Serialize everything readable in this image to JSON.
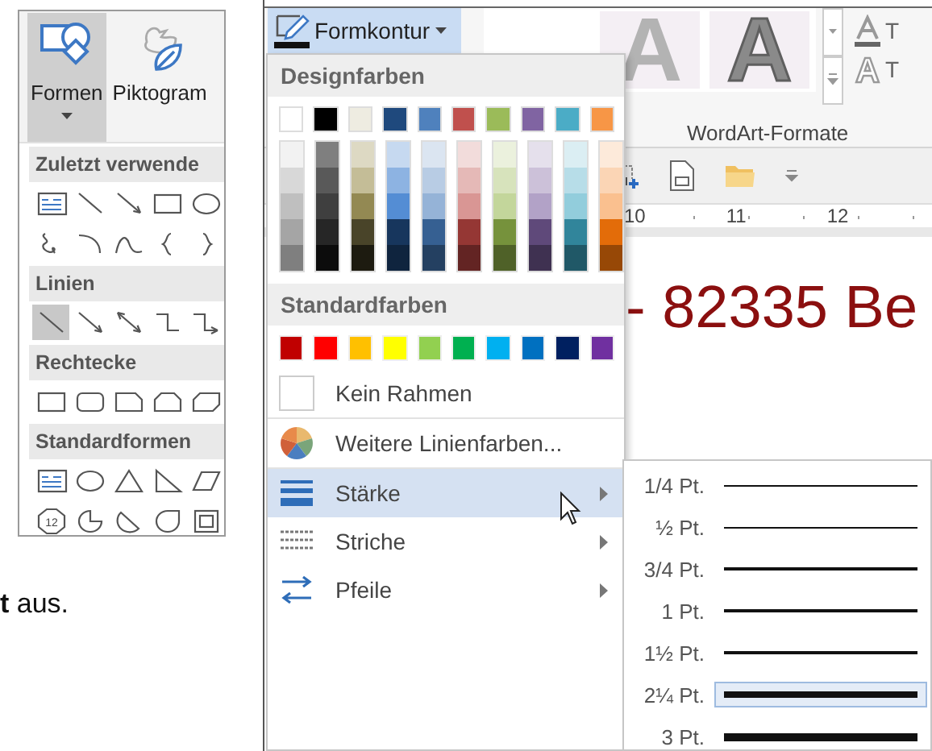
{
  "left_panel": {
    "buttons": [
      {
        "label": "Formen",
        "kind": "shapes",
        "selected": true
      },
      {
        "label": "Piktogram",
        "kind": "icons",
        "selected": false
      }
    ],
    "sections": [
      {
        "title": "Zuletzt verwende",
        "rows": [
          [
            {
              "kind": "textbox",
              "selected": false
            },
            {
              "kind": "line",
              "selected": false
            },
            {
              "kind": "arrow",
              "selected": false
            },
            {
              "kind": "rect",
              "selected": false
            },
            {
              "kind": "oval",
              "selected": false
            }
          ],
          [
            {
              "kind": "scribble",
              "selected": false
            },
            {
              "kind": "arc",
              "selected": false
            },
            {
              "kind": "wave",
              "selected": false
            },
            {
              "kind": "brace-left",
              "selected": false
            },
            {
              "kind": "brace-right",
              "selected": false
            }
          ]
        ]
      },
      {
        "title": "Linien",
        "rows": [
          [
            {
              "kind": "line",
              "selected": true
            },
            {
              "kind": "arrow",
              "selected": false
            },
            {
              "kind": "double-arrow",
              "selected": false
            },
            {
              "kind": "elbow",
              "selected": false
            },
            {
              "kind": "elbow-arrow",
              "selected": false
            }
          ]
        ]
      },
      {
        "title": "Rechtecke",
        "rows": [
          [
            {
              "kind": "rect",
              "selected": false
            },
            {
              "kind": "rounded-rect",
              "selected": false
            },
            {
              "kind": "snip-rect",
              "selected": false
            },
            {
              "kind": "snip2-rect",
              "selected": false
            },
            {
              "kind": "snip-diag",
              "selected": false
            }
          ]
        ]
      },
      {
        "title": "Standardformen",
        "rows": [
          [
            {
              "kind": "textbox",
              "selected": false
            },
            {
              "kind": "oval",
              "selected": false
            },
            {
              "kind": "triangle",
              "selected": false
            },
            {
              "kind": "right-triangle",
              "selected": false
            },
            {
              "kind": "parallelogram",
              "selected": false
            }
          ],
          [
            {
              "kind": "octagon",
              "label": "12",
              "selected": false
            },
            {
              "kind": "pie",
              "selected": false
            },
            {
              "kind": "chord",
              "selected": false
            },
            {
              "kind": "teardrop",
              "selected": false
            },
            {
              "kind": "frame",
              "selected": false
            }
          ]
        ]
      }
    ],
    "caption": "**t** aus."
  },
  "ribbon": {
    "outline_button": {
      "label": "Formkontur",
      "expanded": true
    },
    "wordart_styles": [
      {
        "label": "A",
        "kind": "soft"
      },
      {
        "label": "A",
        "kind": "outline"
      }
    ],
    "text_buttons": [
      {
        "label": "T",
        "kind": "fill"
      },
      {
        "label": "T",
        "kind": "outline"
      }
    ],
    "group_label": "WordArt-Formate"
  },
  "ruler": {
    "labels": [
      "10",
      "11",
      "12"
    ]
  },
  "document": {
    "lines": [
      "- 82335 Be"
    ]
  },
  "outline_menu": {
    "design_title": "Designfarben",
    "design_colors": [
      {
        "color": "#ffffff",
        "shades": [
          {
            "color": "#f2f2f2"
          },
          {
            "color": "#d8d8d8"
          },
          {
            "color": "#bfbfbf"
          },
          {
            "color": "#a5a5a5"
          },
          {
            "color": "#7f7f7f"
          }
        ]
      },
      {
        "color": "#000000",
        "shades": [
          {
            "color": "#7f7f7f"
          },
          {
            "color": "#595959"
          },
          {
            "color": "#3f3f3f"
          },
          {
            "color": "#262626"
          },
          {
            "color": "#0c0c0c"
          }
        ]
      },
      {
        "color": "#eeece1",
        "shades": [
          {
            "color": "#ddd9c3"
          },
          {
            "color": "#c4bd97"
          },
          {
            "color": "#938953"
          },
          {
            "color": "#494429"
          },
          {
            "color": "#1d1b10"
          }
        ]
      },
      {
        "color": "#1f497d",
        "shades": [
          {
            "color": "#c6d9f0"
          },
          {
            "color": "#8db3e2"
          },
          {
            "color": "#548dd4"
          },
          {
            "color": "#17365d"
          },
          {
            "color": "#0f243e"
          }
        ]
      },
      {
        "color": "#4f81bd",
        "shades": [
          {
            "color": "#dbe5f1"
          },
          {
            "color": "#b8cce4"
          },
          {
            "color": "#95b3d7"
          },
          {
            "color": "#366092"
          },
          {
            "color": "#244061"
          }
        ]
      },
      {
        "color": "#c0504d",
        "shades": [
          {
            "color": "#f2dcdb"
          },
          {
            "color": "#e5b9b7"
          },
          {
            "color": "#d99694"
          },
          {
            "color": "#953734"
          },
          {
            "color": "#632423"
          }
        ]
      },
      {
        "color": "#9bbb59",
        "shades": [
          {
            "color": "#ebf1dd"
          },
          {
            "color": "#d7e3bc"
          },
          {
            "color": "#c3d69b"
          },
          {
            "color": "#76923c"
          },
          {
            "color": "#4f6128"
          }
        ]
      },
      {
        "color": "#8064a2",
        "shades": [
          {
            "color": "#e5e0ec"
          },
          {
            "color": "#ccc1d9"
          },
          {
            "color": "#b2a2c7"
          },
          {
            "color": "#5f497a"
          },
          {
            "color": "#3f3151"
          }
        ]
      },
      {
        "color": "#4bacc6",
        "shades": [
          {
            "color": "#dbeef3"
          },
          {
            "color": "#b7dde8"
          },
          {
            "color": "#92cddc"
          },
          {
            "color": "#31859b"
          },
          {
            "color": "#205867"
          }
        ]
      },
      {
        "color": "#f79646",
        "shades": [
          {
            "color": "#fdeada"
          },
          {
            "color": "#fbd5b5"
          },
          {
            "color": "#fac08f"
          },
          {
            "color": "#e36c09"
          },
          {
            "color": "#974806"
          }
        ]
      }
    ],
    "standard_title": "Standardfarben",
    "standard_colors": [
      {
        "color": "#c00000"
      },
      {
        "color": "#ff0000"
      },
      {
        "color": "#ffc000"
      },
      {
        "color": "#ffff00"
      },
      {
        "color": "#92d050"
      },
      {
        "color": "#00b050"
      },
      {
        "color": "#00b0f0"
      },
      {
        "color": "#0070c0"
      },
      {
        "color": "#002060"
      },
      {
        "color": "#7030a0"
      }
    ],
    "items": [
      {
        "label": "Kein Rahmen",
        "kind": "no-outline",
        "selected": false,
        "submenu": false
      },
      {
        "label": "Weitere Linienfarben...",
        "kind": "more-colors",
        "selected": false,
        "submenu": false
      },
      {
        "label": "Stärke",
        "kind": "weight",
        "selected": true,
        "submenu": true
      },
      {
        "label": "Striche",
        "kind": "dashes",
        "selected": false,
        "submenu": true
      },
      {
        "label": "Pfeile",
        "kind": "arrows",
        "selected": false,
        "submenu": true
      }
    ]
  },
  "weight_menu": [
    {
      "label": "1/4 Pt.",
      "selected": false
    },
    {
      "label": "½ Pt.",
      "selected": false
    },
    {
      "label": "3/4 Pt.",
      "selected": false
    },
    {
      "label": "1 Pt.",
      "selected": false
    },
    {
      "label": "1½ Pt.",
      "selected": false
    },
    {
      "label": "2¼ Pt.",
      "selected": true
    },
    {
      "label": "3 Pt.",
      "selected": false
    }
  ]
}
